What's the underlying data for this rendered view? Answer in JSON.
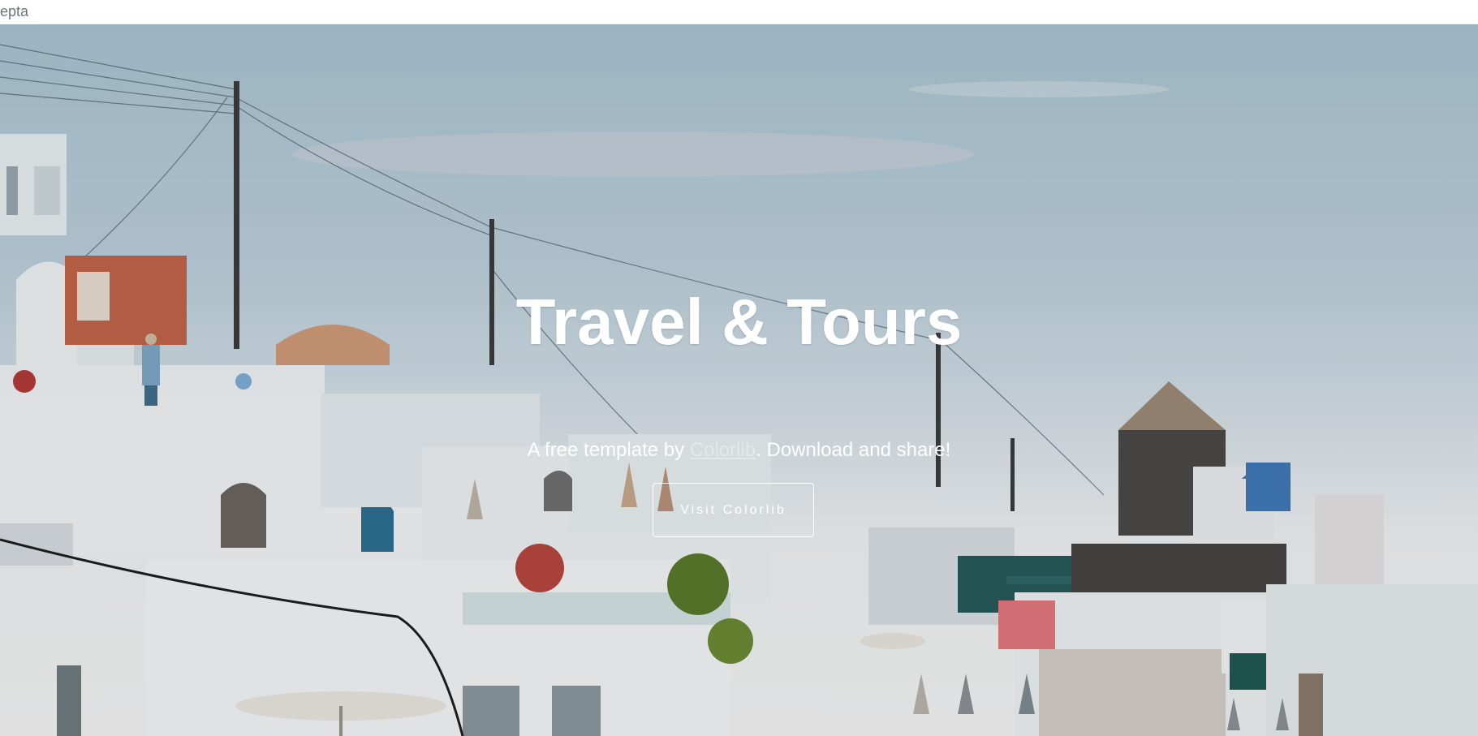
{
  "brand": {
    "text": "epta"
  },
  "hero": {
    "background_image": "santorini-village-photo",
    "title": "Travel & Tours",
    "subtitle_before": "A free template by ",
    "subtitle_link": "Colorlib",
    "subtitle_after": ". Download and share!",
    "cta_label": "Visit Colorlib"
  },
  "colors": {
    "text": "#ffffff",
    "brand": "#6c757d",
    "sky": "#a9c4d2"
  }
}
